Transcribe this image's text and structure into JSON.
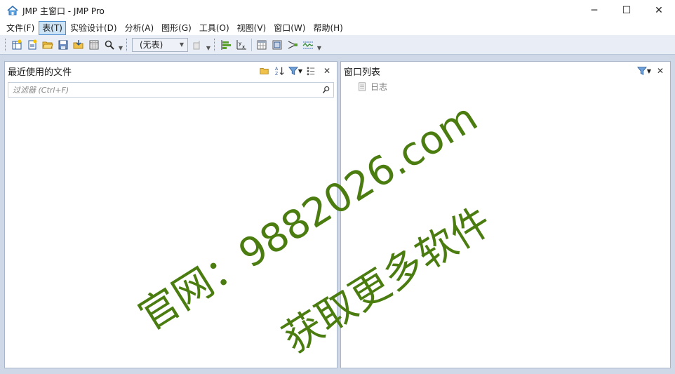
{
  "window": {
    "title": "JMP 主窗口 - JMP Pro",
    "app_icon": "home-icon",
    "controls": {
      "minimize": "─",
      "maximize": "☐",
      "close": "✕"
    }
  },
  "menu": [
    {
      "label": "文件(F)",
      "active": false
    },
    {
      "label": "表(T)",
      "active": true
    },
    {
      "label": "实验设计(D)",
      "active": false
    },
    {
      "label": "分析(A)",
      "active": false
    },
    {
      "label": "图形(G)",
      "active": false
    },
    {
      "label": "工具(O)",
      "active": false
    },
    {
      "label": "视图(V)",
      "active": false
    },
    {
      "label": "窗口(W)",
      "active": false
    },
    {
      "label": "帮助(H)",
      "active": false
    }
  ],
  "toolbar": {
    "combo_value": "(无表)"
  },
  "recent_files": {
    "title": "最近使用的文件",
    "filter_placeholder": "过滤器 (Ctrl+F)"
  },
  "window_list": {
    "title": "窗口列表",
    "items": [
      {
        "label": "日志",
        "icon": "log-icon"
      }
    ]
  },
  "watermark": {
    "line1": "官网：9882026.com",
    "line2": "获取更多软件"
  },
  "colors": {
    "accent": "#4f8fd0",
    "watermark": "#4a7c10",
    "toolbar_bg": "#e9eef6"
  }
}
